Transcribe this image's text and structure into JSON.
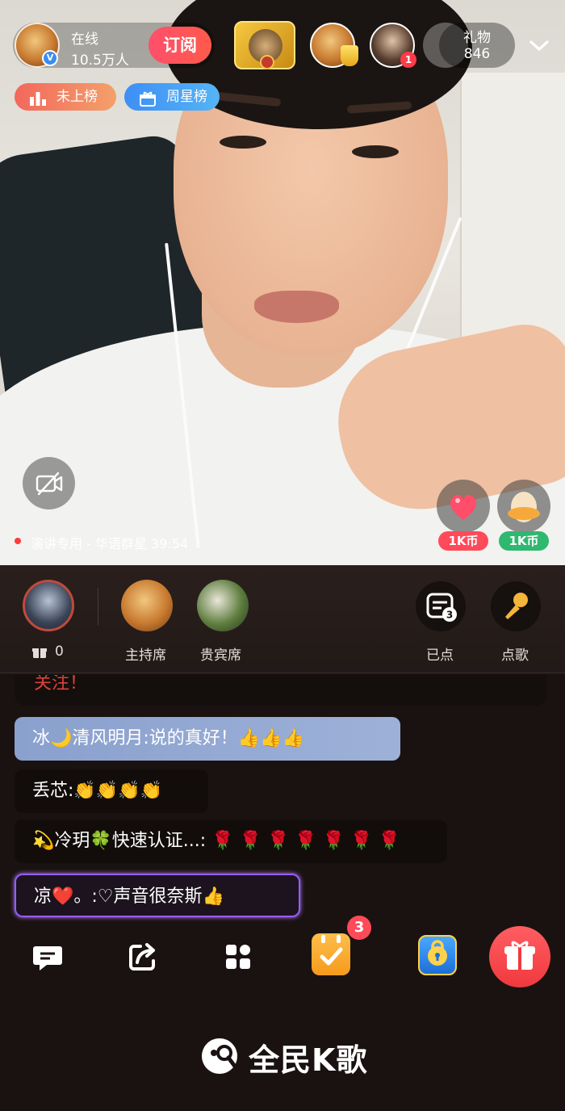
{
  "header": {
    "online_label": "在线",
    "online_count": "10.5万人",
    "subscribe_label": "订阅",
    "gift_label": "礼物",
    "gift_count": "846",
    "top_user_badge": "1"
  },
  "rank_tags": {
    "not_ranked": "未上榜",
    "weekly_star": "周星榜"
  },
  "stream": {
    "song_info": "演讲专用 - 华语群星 39:54"
  },
  "quick_gifts": [
    {
      "name": "heart",
      "price": "1K币"
    },
    {
      "name": "egg",
      "price": "1K币"
    }
  ],
  "seats": {
    "gift_count": "0",
    "host_seat_label": "主持席",
    "guest_seat_label": "贵宾席",
    "requested_label": "已点",
    "requested_count": "3",
    "request_song_label": "点歌"
  },
  "chat": {
    "faded_message": "关注！",
    "messages": [
      {
        "text": "冰🌙清风明月:说的真好！👍👍👍"
      },
      {
        "text": "丢芯:👏👏👏👏"
      },
      {
        "text": "💫冷玥🍀快速认证...: 🌹 🌹 🌹 🌹 🌹 🌹 🌹"
      },
      {
        "text": "凉❤️。:♡声音很奈斯👍"
      }
    ]
  },
  "toolbar": {
    "task_badge": "3"
  },
  "watermark": {
    "text": "全民K歌"
  },
  "colors": {
    "subscribe": "#ff4f6c",
    "coin_red": "#ff4a5a",
    "coin_green": "#2fb86f",
    "gift_button": "#f0393e",
    "vip_frame": "#9a5cff"
  }
}
